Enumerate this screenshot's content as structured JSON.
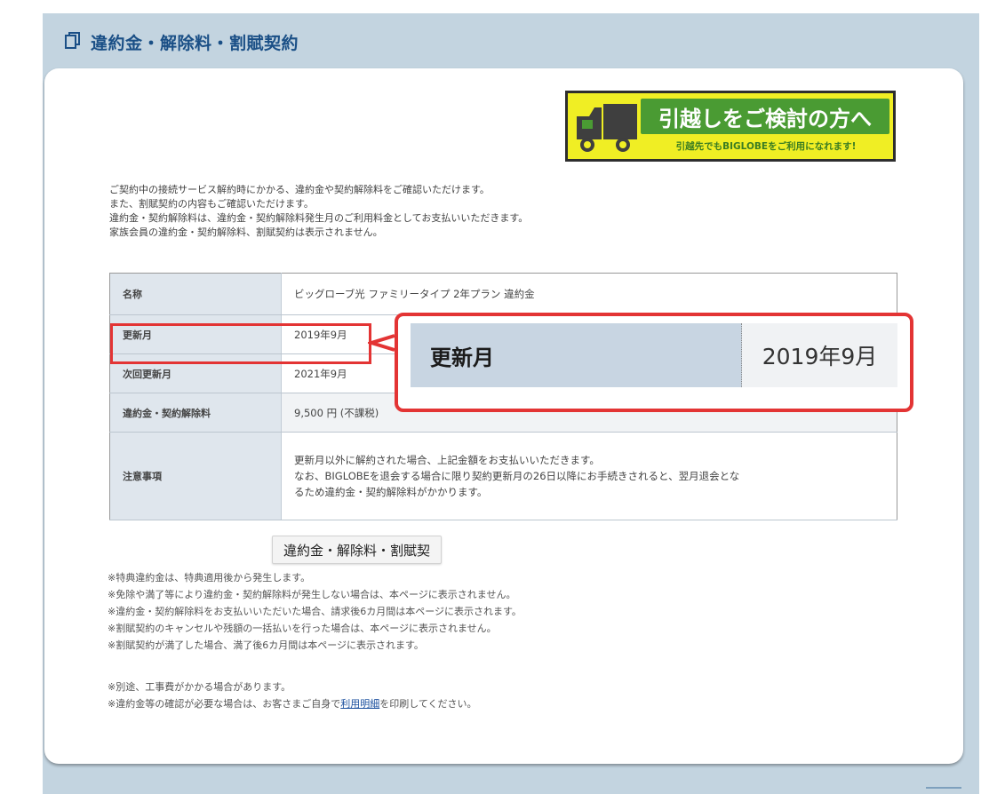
{
  "page": {
    "title": "違約金・解除料・割賦契約"
  },
  "banner": {
    "main": "引越しをご検討の方へ",
    "sub": "引越先でもBIGLOBEをご利用になれます!"
  },
  "intro": [
    "ご契約中の接続サービス解約時にかかる、違約金や契約解除料をご確認いただけます。",
    "また、割賦契約の内容もご確認いただけます。",
    "違約金・契約解除料は、違約金・契約解除料発生月のご利用料金としてお支払いいただきます。",
    "家族会員の違約金・契約解除料、割賦契約は表示されません。"
  ],
  "table": {
    "rows": [
      {
        "label": "名称",
        "value": "ビッグローブ光 ファミリータイプ 2年プラン 違約金"
      },
      {
        "label": "更新月",
        "value": "2019年9月"
      },
      {
        "label": "次回更新月",
        "value": "2021年9月"
      },
      {
        "label": "違約金・契約解除料",
        "value": "9,500 円 (不課税)"
      },
      {
        "label": "注意事項",
        "value_lines": [
          "更新月以外に解約された場合、上記金額をお支払いいただきます。",
          "なお、BIGLOBEを退会する場合に限り契約更新月の26日以降にお手続きされると、翌月退会とな",
          "るため違約金・契約解除料がかかります。"
        ]
      }
    ]
  },
  "callout": {
    "label": "更新月",
    "value": "2019年9月"
  },
  "tooltip": "違約金・解除料・割賦契",
  "notes": [
    "※特典違約金は、特典適用後から発生します。",
    "※免除や満了等により違約金・契約解除料が発生しない場合は、本ページに表示されません。",
    "※違約金・契約解除料をお支払いいただいた場合、請求後6カ月間は本ページに表示されます。",
    "※割賦契約のキャンセルや残額の一括払いを行った場合は、本ページに表示されません。",
    "※割賦契約が満了した場合、満了後6カ月間は本ページに表示されます。"
  ],
  "notes2": {
    "line1": "※別途、工事費がかかる場合があります。",
    "line2_prefix": "※違約金等の確認が必要な場合は、お客さまご自身で",
    "line2_link": "利用明細",
    "line2_suffix": "を印刷してください。"
  },
  "colors": {
    "title": "#1a4f86",
    "highlight": "#e33434",
    "banner_bg": "#f0ee24",
    "banner_green": "#4a9b33"
  }
}
